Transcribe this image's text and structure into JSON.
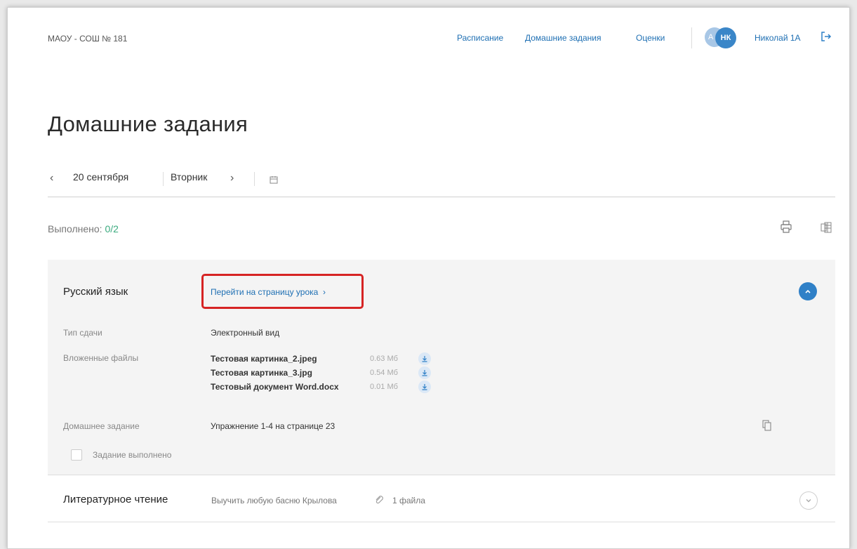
{
  "header": {
    "school_name": "МАОУ - СОШ № 181",
    "nav": {
      "schedule": "Расписание",
      "homework": "Домашние задания",
      "grades": "Оценки"
    },
    "avatar_back_initials": "А",
    "avatar_initials": "НК",
    "user_name": "Николай 1А"
  },
  "page": {
    "title": "Домашние задания"
  },
  "date_nav": {
    "date": "20 сентября",
    "day": "Вторник"
  },
  "status": {
    "done_label": "Выполнено:",
    "done_value": "0/2"
  },
  "subjects": [
    {
      "name": "Русский язык",
      "lesson_link": "Перейти на страницу урока",
      "submission_type_label": "Тип сдачи",
      "submission_type_value": "Электронный вид",
      "attachments_label": "Вложенные файлы",
      "files": [
        {
          "name": "Тестовая картинка_2.jpeg",
          "size": "0.63 Мб"
        },
        {
          "name": "Тестовая картинка_3.jpg",
          "size": "0.54 Мб"
        },
        {
          "name": "Тестовый документ Word.docx",
          "size": "0.01 Мб"
        }
      ],
      "homework_label": "Домашнее задание",
      "homework_value": "Упражнение 1-4 на странице 23",
      "done_checkbox_label": "Задание выполнено"
    },
    {
      "name": "Литературное чтение",
      "task": "Выучить любую басню Крылова",
      "files_count": "1 файла"
    }
  ],
  "colors": {
    "link": "#1e6fb3",
    "accent": "#2f80c7",
    "done_green": "#3bab7f",
    "highlight": "#d62424"
  }
}
